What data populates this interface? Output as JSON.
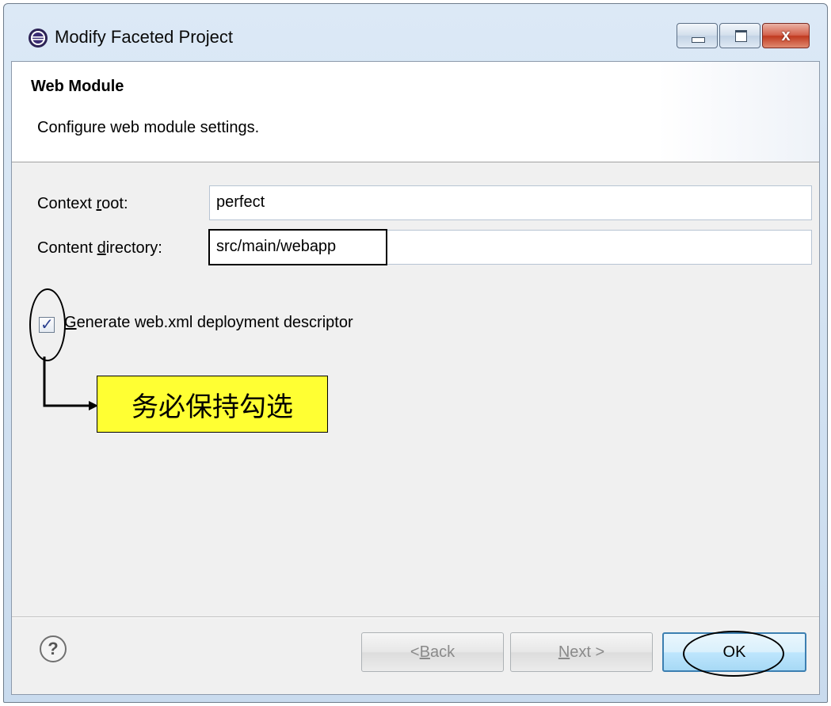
{
  "window": {
    "title": "Modify Faceted Project",
    "minimize_glyph": "",
    "maximize_glyph": "",
    "close_glyph": "x"
  },
  "banner": {
    "title": "Web Module",
    "description": "Configure web module settings."
  },
  "form": {
    "context_root_label_pre": "Context ",
    "context_root_label_mnemonic": "r",
    "context_root_label_post": "oot:",
    "context_root_value": "perfect",
    "content_dir_label_pre": "Content ",
    "content_dir_label_mnemonic": "d",
    "content_dir_label_post": "irectory:",
    "content_dir_value": "src/main/webapp",
    "generate_checkbox_checked": true,
    "generate_label_mnemonic": "G",
    "generate_label_post": "enerate web.xml deployment descriptor"
  },
  "annotation": {
    "callout_text": "务必保持勾选"
  },
  "buttons": {
    "help_glyph": "?",
    "back_pre": "< ",
    "back_mnemonic": "B",
    "back_post": "ack",
    "next_mnemonic": "N",
    "next_post": "ext >",
    "ok_label": "OK"
  },
  "colors": {
    "callout_background": "#ffff33",
    "ok_button_border": "#3c7fb1",
    "close_button": "#c0391f"
  },
  "icons": {
    "app": "eclipse-icon",
    "help": "help-icon",
    "checkbox": "checkmark-icon"
  }
}
